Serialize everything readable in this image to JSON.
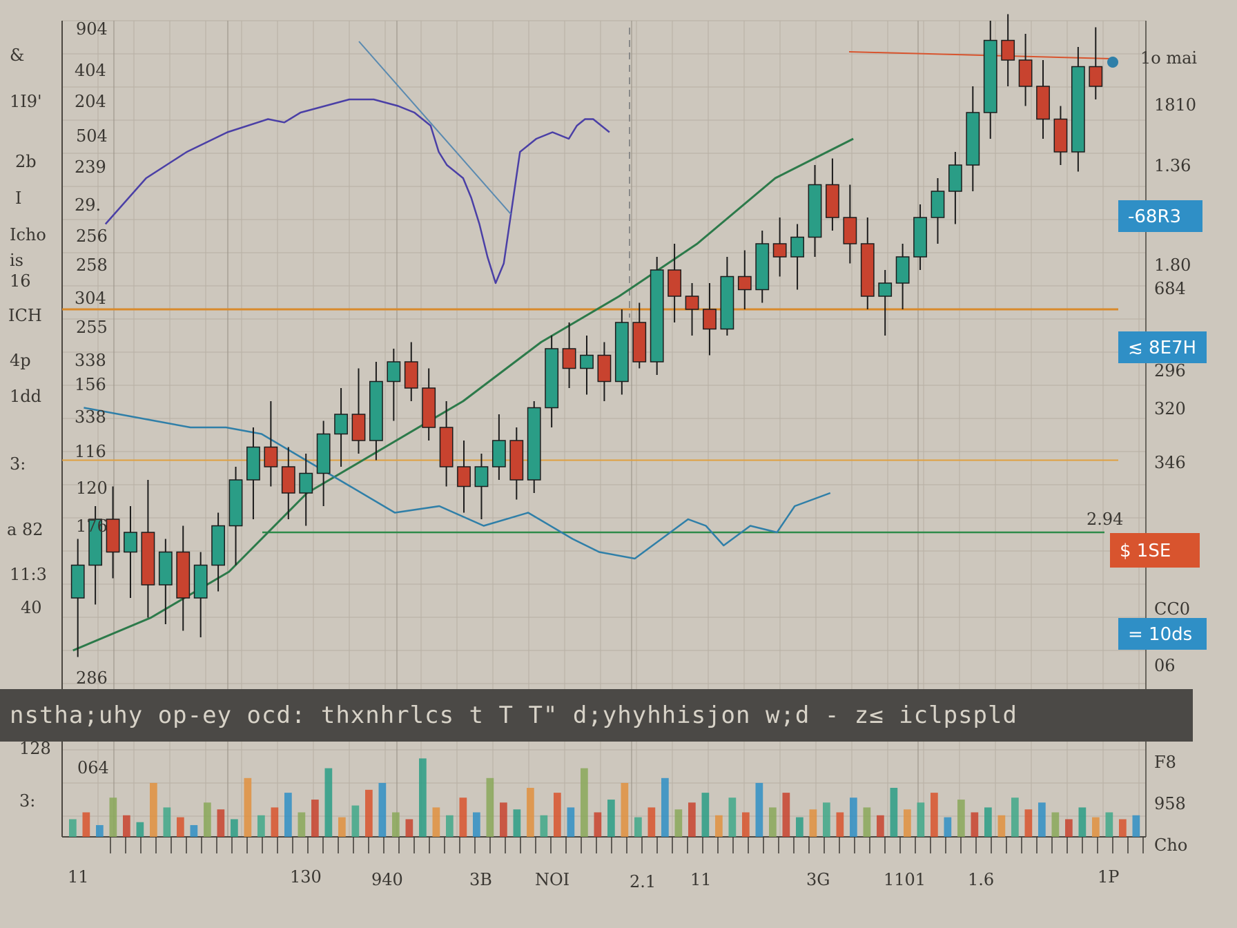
{
  "chart_data": {
    "type": "candlestick",
    "title": "",
    "xlabel": "",
    "ylabel": "",
    "grid": true,
    "legend": "none",
    "ylim": [
      0,
      1000
    ],
    "candles": [
      {
        "x": 1,
        "o": 120,
        "h": 210,
        "l": 30,
        "c": 170
      },
      {
        "x": 2,
        "o": 170,
        "h": 260,
        "l": 110,
        "c": 240
      },
      {
        "x": 3,
        "o": 240,
        "h": 290,
        "l": 150,
        "c": 190
      },
      {
        "x": 4,
        "o": 190,
        "h": 260,
        "l": 120,
        "c": 220
      },
      {
        "x": 5,
        "o": 220,
        "h": 300,
        "l": 90,
        "c": 140
      },
      {
        "x": 6,
        "o": 140,
        "h": 210,
        "l": 80,
        "c": 190
      },
      {
        "x": 7,
        "o": 190,
        "h": 230,
        "l": 70,
        "c": 120
      },
      {
        "x": 8,
        "o": 120,
        "h": 190,
        "l": 60,
        "c": 170
      },
      {
        "x": 9,
        "o": 170,
        "h": 250,
        "l": 130,
        "c": 230
      },
      {
        "x": 10,
        "o": 230,
        "h": 320,
        "l": 170,
        "c": 300
      },
      {
        "x": 11,
        "o": 300,
        "h": 380,
        "l": 240,
        "c": 350
      },
      {
        "x": 12,
        "o": 350,
        "h": 420,
        "l": 290,
        "c": 320
      },
      {
        "x": 13,
        "o": 320,
        "h": 350,
        "l": 240,
        "c": 280
      },
      {
        "x": 14,
        "o": 280,
        "h": 340,
        "l": 230,
        "c": 310
      },
      {
        "x": 15,
        "o": 310,
        "h": 390,
        "l": 260,
        "c": 370
      },
      {
        "x": 16,
        "o": 370,
        "h": 440,
        "l": 320,
        "c": 400
      },
      {
        "x": 17,
        "o": 400,
        "h": 470,
        "l": 340,
        "c": 360
      },
      {
        "x": 18,
        "o": 360,
        "h": 480,
        "l": 330,
        "c": 450
      },
      {
        "x": 19,
        "o": 450,
        "h": 500,
        "l": 390,
        "c": 480
      },
      {
        "x": 20,
        "o": 480,
        "h": 510,
        "l": 420,
        "c": 440
      },
      {
        "x": 21,
        "o": 440,
        "h": 470,
        "l": 360,
        "c": 380
      },
      {
        "x": 22,
        "o": 380,
        "h": 420,
        "l": 290,
        "c": 320
      },
      {
        "x": 23,
        "o": 320,
        "h": 360,
        "l": 250,
        "c": 290
      },
      {
        "x": 24,
        "o": 290,
        "h": 340,
        "l": 240,
        "c": 320
      },
      {
        "x": 25,
        "o": 320,
        "h": 400,
        "l": 300,
        "c": 360
      },
      {
        "x": 26,
        "o": 360,
        "h": 380,
        "l": 270,
        "c": 300
      },
      {
        "x": 27,
        "o": 300,
        "h": 420,
        "l": 280,
        "c": 410
      },
      {
        "x": 28,
        "o": 410,
        "h": 520,
        "l": 380,
        "c": 500
      },
      {
        "x": 29,
        "o": 500,
        "h": 540,
        "l": 440,
        "c": 470
      },
      {
        "x": 30,
        "o": 470,
        "h": 520,
        "l": 430,
        "c": 490
      },
      {
        "x": 31,
        "o": 490,
        "h": 510,
        "l": 420,
        "c": 450
      },
      {
        "x": 32,
        "o": 450,
        "h": 560,
        "l": 430,
        "c": 540
      },
      {
        "x": 33,
        "o": 540,
        "h": 570,
        "l": 470,
        "c": 480
      },
      {
        "x": 34,
        "o": 480,
        "h": 640,
        "l": 460,
        "c": 620
      },
      {
        "x": 35,
        "o": 620,
        "h": 660,
        "l": 540,
        "c": 580
      },
      {
        "x": 36,
        "o": 580,
        "h": 600,
        "l": 520,
        "c": 560
      },
      {
        "x": 37,
        "o": 560,
        "h": 600,
        "l": 490,
        "c": 530
      },
      {
        "x": 38,
        "o": 530,
        "h": 640,
        "l": 520,
        "c": 610
      },
      {
        "x": 39,
        "o": 610,
        "h": 650,
        "l": 560,
        "c": 590
      },
      {
        "x": 40,
        "o": 590,
        "h": 680,
        "l": 570,
        "c": 660
      },
      {
        "x": 41,
        "o": 660,
        "h": 700,
        "l": 610,
        "c": 640
      },
      {
        "x": 42,
        "o": 640,
        "h": 690,
        "l": 590,
        "c": 670
      },
      {
        "x": 43,
        "o": 670,
        "h": 780,
        "l": 640,
        "c": 750
      },
      {
        "x": 44,
        "o": 750,
        "h": 790,
        "l": 680,
        "c": 700
      },
      {
        "x": 45,
        "o": 700,
        "h": 750,
        "l": 630,
        "c": 660
      },
      {
        "x": 46,
        "o": 660,
        "h": 700,
        "l": 560,
        "c": 580
      },
      {
        "x": 47,
        "o": 580,
        "h": 620,
        "l": 520,
        "c": 600
      },
      {
        "x": 48,
        "o": 600,
        "h": 660,
        "l": 560,
        "c": 640
      },
      {
        "x": 49,
        "o": 640,
        "h": 720,
        "l": 620,
        "c": 700
      },
      {
        "x": 50,
        "o": 700,
        "h": 760,
        "l": 660,
        "c": 740
      },
      {
        "x": 51,
        "o": 740,
        "h": 800,
        "l": 690,
        "c": 780
      },
      {
        "x": 52,
        "o": 780,
        "h": 900,
        "l": 740,
        "c": 860
      },
      {
        "x": 53,
        "o": 860,
        "h": 1000,
        "l": 820,
        "c": 970
      },
      {
        "x": 54,
        "o": 970,
        "h": 1010,
        "l": 900,
        "c": 940
      },
      {
        "x": 55,
        "o": 940,
        "h": 980,
        "l": 870,
        "c": 900
      },
      {
        "x": 56,
        "o": 900,
        "h": 940,
        "l": 820,
        "c": 850
      },
      {
        "x": 57,
        "o": 850,
        "h": 870,
        "l": 780,
        "c": 800
      },
      {
        "x": 58,
        "o": 800,
        "h": 960,
        "l": 770,
        "c": 930
      },
      {
        "x": 59,
        "o": 930,
        "h": 990,
        "l": 880,
        "c": 900
      }
    ],
    "overlays": {
      "purple_line": [
        [
          0.0,
          690
        ],
        [
          0.05,
          760
        ],
        [
          0.1,
          800
        ],
        [
          0.15,
          830
        ],
        [
          0.2,
          850
        ],
        [
          0.22,
          845
        ],
        [
          0.24,
          860
        ],
        [
          0.27,
          870
        ],
        [
          0.3,
          880
        ],
        [
          0.33,
          880
        ],
        [
          0.36,
          870
        ],
        [
          0.38,
          860
        ],
        [
          0.4,
          840
        ],
        [
          0.41,
          800
        ],
        [
          0.42,
          780
        ],
        [
          0.44,
          760
        ],
        [
          0.45,
          730
        ],
        [
          0.46,
          690
        ],
        [
          0.47,
          640
        ],
        [
          0.48,
          600
        ],
        [
          0.49,
          630
        ],
        [
          0.51,
          800
        ],
        [
          0.53,
          820
        ],
        [
          0.55,
          830
        ],
        [
          0.57,
          820
        ],
        [
          0.58,
          840
        ],
        [
          0.59,
          850
        ],
        [
          0.6,
          850
        ],
        [
          0.62,
          830
        ]
      ],
      "green_trend": [
        [
          0.0,
          40
        ],
        [
          0.1,
          90
        ],
        [
          0.2,
          160
        ],
        [
          0.3,
          280
        ],
        [
          0.4,
          350
        ],
        [
          0.5,
          420
        ],
        [
          0.6,
          510
        ],
        [
          0.7,
          580
        ],
        [
          0.8,
          660
        ],
        [
          0.9,
          760
        ],
        [
          1.0,
          820
        ]
      ],
      "blue_line": [
        [
          0.0,
          410
        ],
        [
          0.04,
          400
        ],
        [
          0.08,
          390
        ],
        [
          0.12,
          380
        ],
        [
          0.16,
          380
        ],
        [
          0.2,
          370
        ],
        [
          0.25,
          330
        ],
        [
          0.3,
          290
        ],
        [
          0.35,
          250
        ],
        [
          0.4,
          260
        ],
        [
          0.45,
          230
        ],
        [
          0.5,
          250
        ],
        [
          0.55,
          210
        ],
        [
          0.58,
          190
        ],
        [
          0.62,
          180
        ],
        [
          0.65,
          210
        ],
        [
          0.68,
          240
        ],
        [
          0.7,
          230
        ],
        [
          0.72,
          200
        ],
        [
          0.75,
          230
        ],
        [
          0.78,
          220
        ],
        [
          0.8,
          260
        ],
        [
          0.84,
          280
        ]
      ],
      "orange_level": 560,
      "orange_level_low": 330,
      "green_level": 220
    },
    "volume": [
      18,
      25,
      12,
      40,
      22,
      15,
      55,
      30,
      20,
      12,
      35,
      28,
      18,
      60,
      22,
      30,
      45,
      25,
      38,
      70,
      20,
      32,
      48,
      55,
      25,
      18,
      80,
      30,
      22,
      40,
      25,
      60,
      35,
      28,
      50,
      22,
      45,
      30,
      70,
      25,
      38,
      55,
      20,
      30,
      60,
      28,
      35,
      45,
      22,
      40,
      25,
      55,
      30,
      45,
      20,
      28,
      35,
      25,
      40,
      30,
      22,
      50,
      28,
      35,
      45,
      20,
      38,
      25,
      30,
      22,
      40,
      28,
      35,
      25,
      18,
      30,
      20,
      25,
      18,
      22
    ]
  },
  "left_labels": [
    "&",
    "1I9'",
    "2b",
    "I",
    "Icho",
    "is",
    "16",
    "ICH",
    "4p",
    "1dd",
    "3:",
    "a 82",
    "11:3",
    "40",
    "128",
    "3:"
  ],
  "y_axis_inner_labels": [
    "904",
    "404",
    "204",
    "504",
    "239",
    "29.",
    "256",
    "258",
    "304",
    "255",
    "338",
    "156",
    "338",
    "116",
    "120",
    "176",
    "286",
    "064"
  ],
  "right_labels": [
    "1o mai",
    "1810",
    "1.36",
    "1.80",
    "684",
    "296",
    "320",
    "346",
    "2.94",
    "CC0",
    "06",
    "F8",
    "958",
    "Cho"
  ],
  "bottom_labels": [
    "11",
    "130",
    "940",
    "3B",
    "NOI",
    "2.1",
    "11",
    "3G",
    "1101",
    "1.6",
    "1P"
  ],
  "boxes": [
    {
      "label": "-68R3",
      "color": "#2f8fc6"
    },
    {
      "label": "≲ 8E7H",
      "color": "#2f8fc6"
    },
    {
      "label": "$ 1SE",
      "color": "#d8542e"
    },
    {
      "label": "= 10ds",
      "color": "#2f8fc6"
    }
  ],
  "band_text": "nstha;uhy op-ey ocd: thxnhrlcs t T T\" d;yhyhhisjon w;d - z≤ iclpspld"
}
